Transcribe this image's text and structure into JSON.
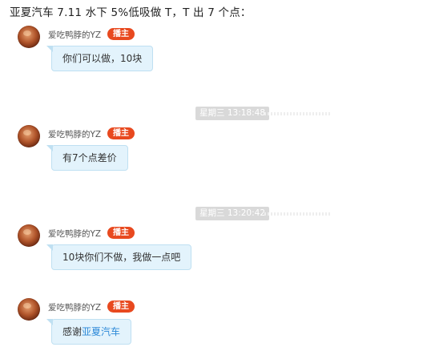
{
  "headline": "亚夏汽车 7.11 水下 5%低吸做 T，T 出 7 个点：",
  "badge_label": "播主",
  "messages": [
    {
      "user": "爱吃鸭脖的YZ",
      "text": "你们可以做，10块"
    },
    {
      "timestamp": "星期三 13:18:48",
      "user": "爱吃鸭脖的YZ",
      "text": "有7个点差价"
    },
    {
      "timestamp": "星期三 13:20:42",
      "user": "爱吃鸭脖的YZ",
      "text": "10块你们不做，我做一点吧"
    },
    {
      "user": "爱吃鸭脖的YZ",
      "text_prefix": "感谢",
      "text_link": "亚夏汽车"
    }
  ],
  "colors": {
    "badge": "#e8491f",
    "bubble": "#e3f3fc",
    "link": "#2e8ad8",
    "timestamp_bg": "#d9d9d9"
  }
}
